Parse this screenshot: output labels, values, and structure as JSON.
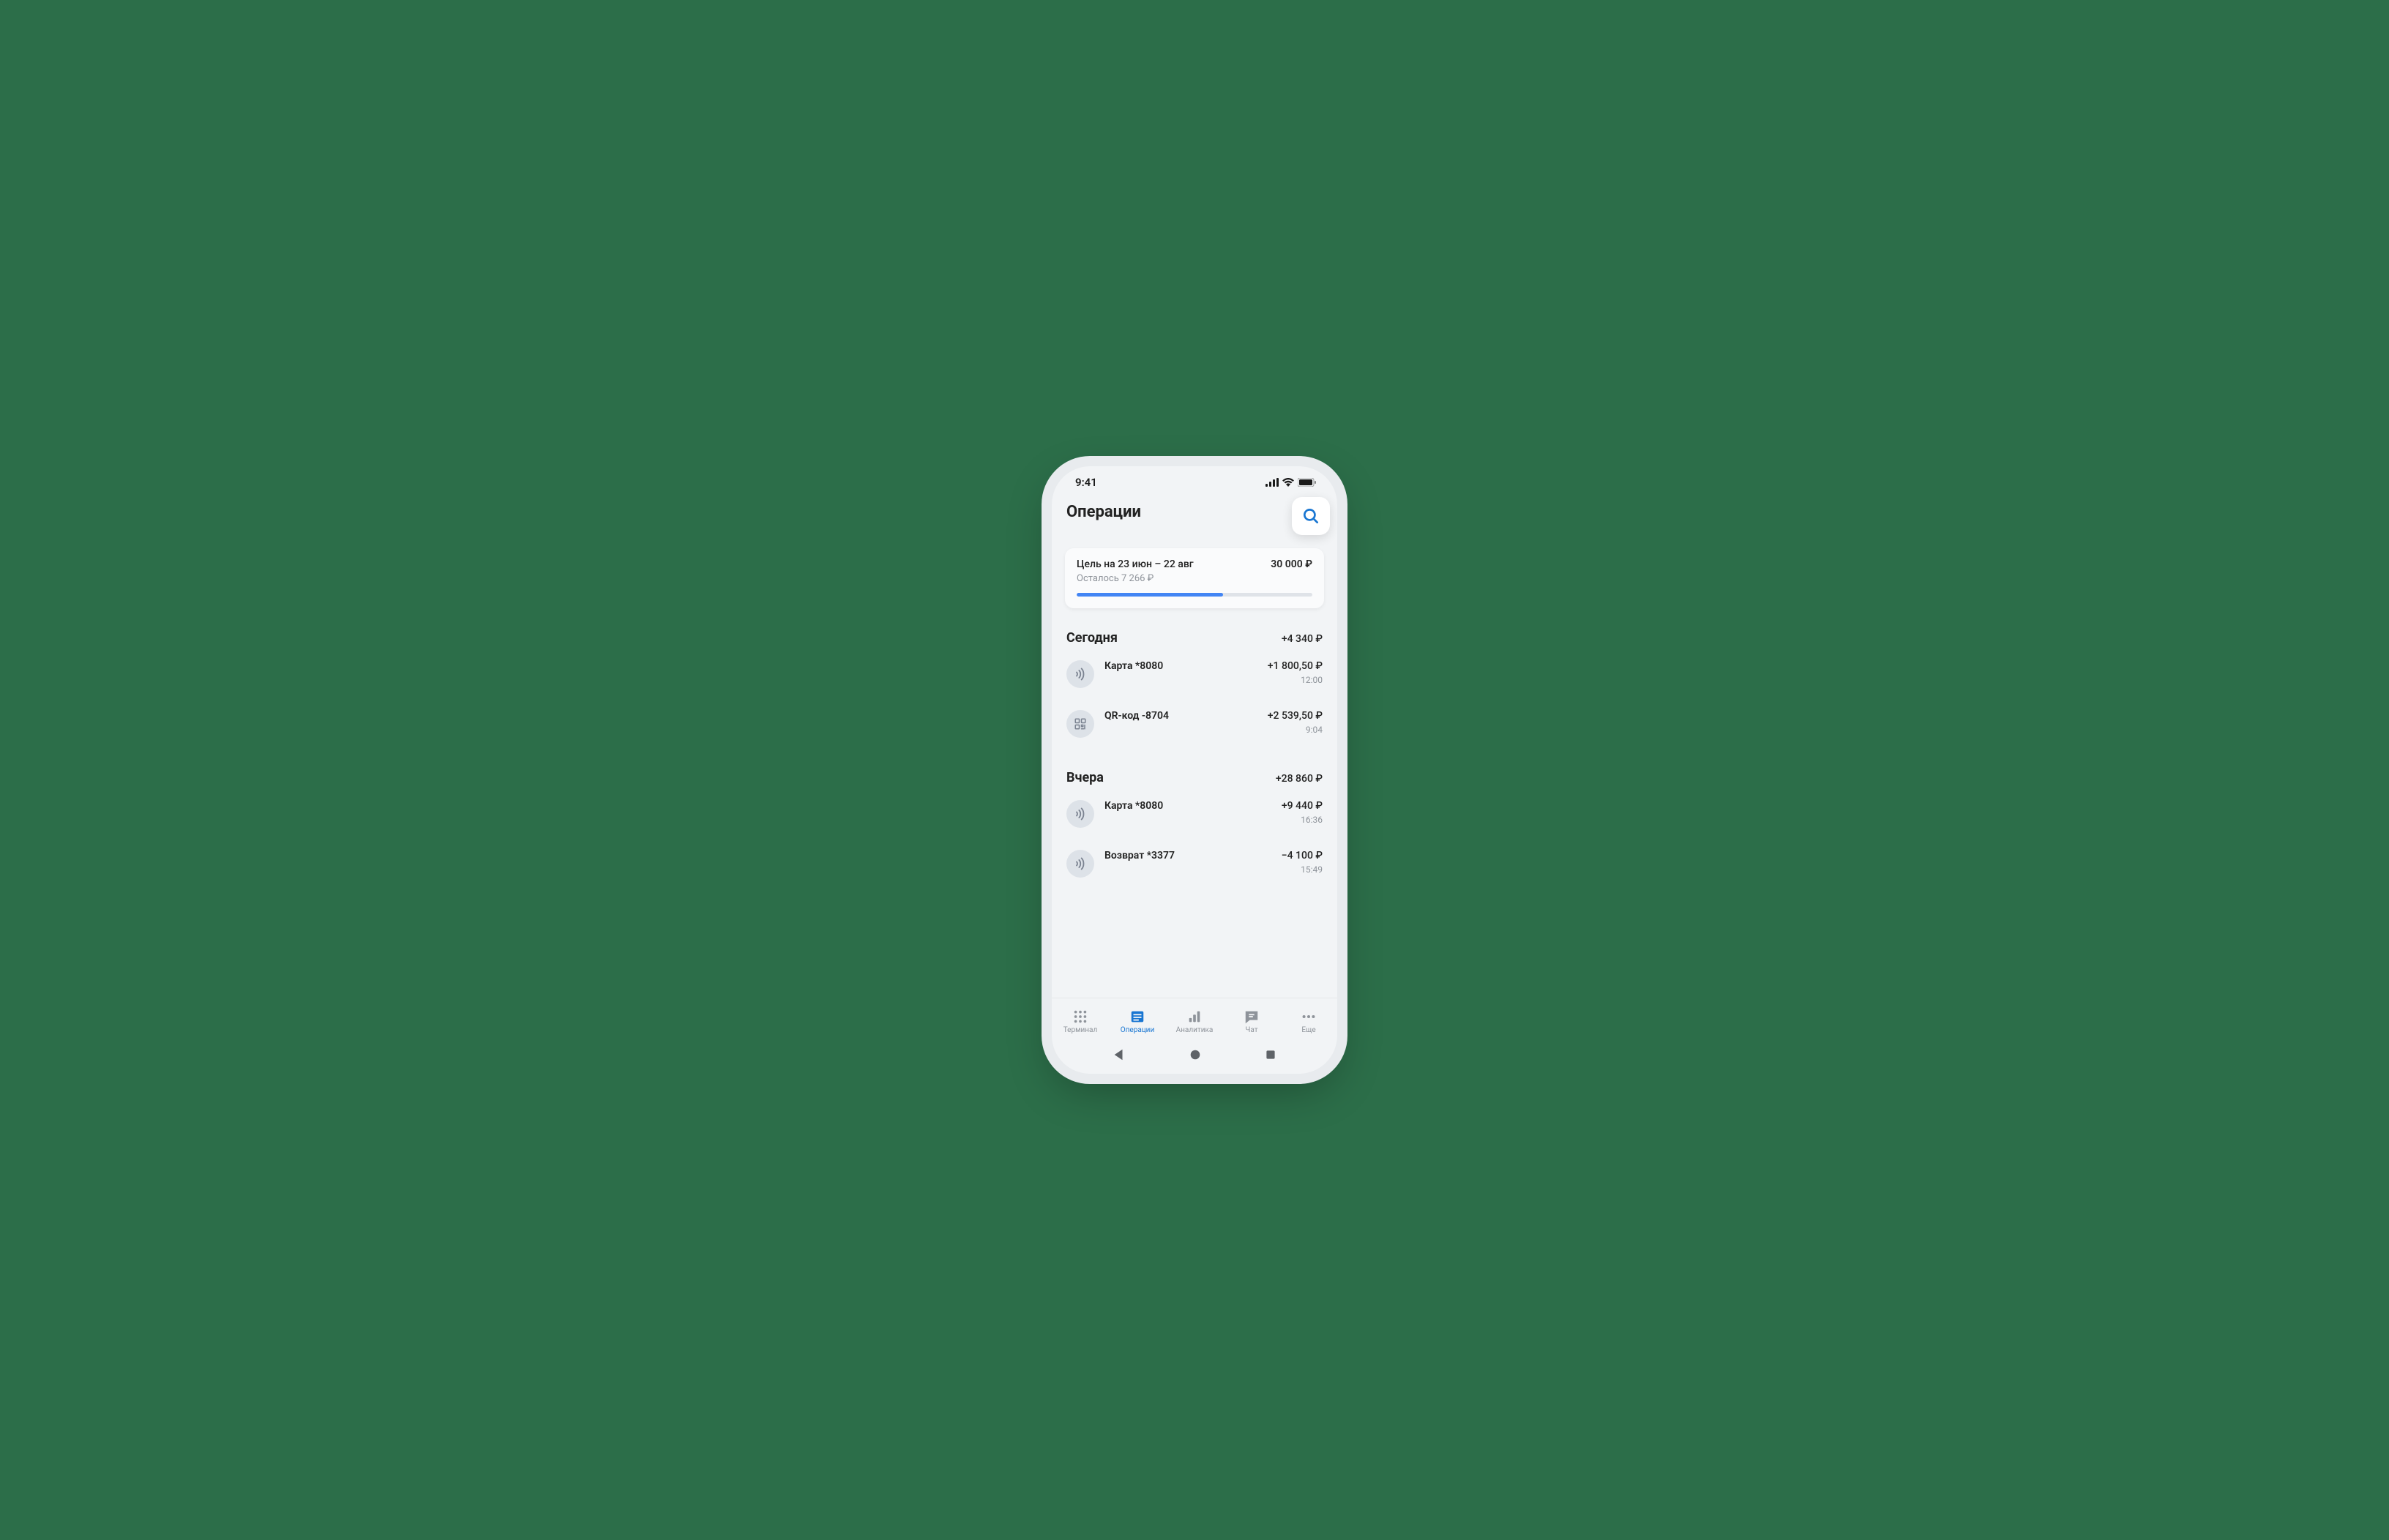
{
  "status": {
    "time": "9:41"
  },
  "header": {
    "title": "Операции"
  },
  "goal": {
    "title": "Цель на 23 июн – 22 авг",
    "amount": "30 000 ₽",
    "remaining": "Осталось 7 266 ₽",
    "progress_pct": 62
  },
  "sections": [
    {
      "title": "Сегодня",
      "sum": "+4 340 ₽",
      "transactions": [
        {
          "icon": "contactless",
          "title": "Карта *8080",
          "amount": "+1 800,50 ₽",
          "time": "12:00"
        },
        {
          "icon": "qr",
          "title": "QR-код -8704",
          "amount": "+2 539,50 ₽",
          "time": "9:04"
        }
      ]
    },
    {
      "title": "Вчера",
      "sum": "+28 860 ₽",
      "transactions": [
        {
          "icon": "contactless",
          "title": "Карта *8080",
          "amount": "+9 440 ₽",
          "time": "16:36"
        },
        {
          "icon": "contactless",
          "title": "Возврат *3377",
          "amount": "−4 100 ₽",
          "time": "15:49"
        }
      ]
    }
  ],
  "tabs": [
    {
      "id": "terminal",
      "label": "Терминал",
      "active": false
    },
    {
      "id": "operations",
      "label": "Операции",
      "active": true
    },
    {
      "id": "analytics",
      "label": "Аналитика",
      "active": false
    },
    {
      "id": "chat",
      "label": "Чат",
      "active": false
    },
    {
      "id": "more",
      "label": "Еще",
      "active": false
    }
  ]
}
